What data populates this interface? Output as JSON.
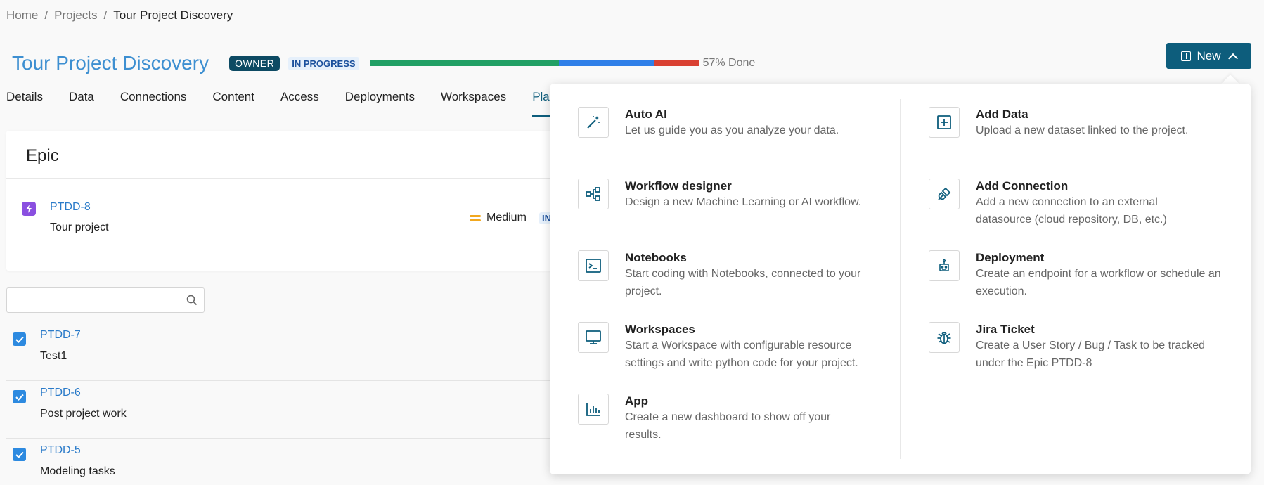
{
  "breadcrumb": {
    "items": [
      "Home",
      "Projects",
      "Tour Project Discovery"
    ],
    "separator": "/"
  },
  "project": {
    "title": "Tour Project Discovery",
    "role_badge": "OWNER",
    "status_badge": "IN PROGRESS",
    "progress_label": "57% Done",
    "progress_segments": [
      {
        "status": "done",
        "fraction": 0.57,
        "color": "#22a065"
      },
      {
        "status": "in_progress",
        "fraction": 0.29,
        "color": "#2f7fe8"
      },
      {
        "status": "other",
        "fraction": 0.14,
        "color": "#d94032"
      }
    ]
  },
  "new_button": {
    "label": "New",
    "icon": "plus-square-icon",
    "chevron": "chevron-up-icon"
  },
  "tabs": [
    {
      "label": "Details",
      "active": false
    },
    {
      "label": "Data",
      "active": false
    },
    {
      "label": "Connections",
      "active": false
    },
    {
      "label": "Content",
      "active": false
    },
    {
      "label": "Access",
      "active": false
    },
    {
      "label": "Deployments",
      "active": false
    },
    {
      "label": "Workspaces",
      "active": false
    },
    {
      "label": "Planni",
      "active": true
    }
  ],
  "epic": {
    "heading": "Epic",
    "key": "PTDD-8",
    "summary": "Tour project",
    "priority": "Medium",
    "status_fragment": "IN",
    "icon": "lightning-icon"
  },
  "search": {
    "value": "",
    "placeholder": ""
  },
  "tasks": [
    {
      "key": "PTDD-7",
      "summary": "Test1",
      "checked": true
    },
    {
      "key": "PTDD-6",
      "summary": "Post project work",
      "checked": true
    },
    {
      "key": "PTDD-5",
      "summary": "Modeling tasks",
      "checked": true
    }
  ],
  "new_menu": {
    "left": [
      {
        "title": "Auto AI",
        "description": "Let us guide you as you analyze your data.",
        "icon": "magic-wand-icon"
      },
      {
        "title": "Workflow designer",
        "description": "Design a new Machine Learning or AI workflow.",
        "icon": "workflow-icon"
      },
      {
        "title": "Notebooks",
        "description": "Start coding with Notebooks, connected to your project.",
        "icon": "terminal-icon"
      },
      {
        "title": "Workspaces",
        "description": "Start a Workspace with configurable resource settings and write python code for your project.",
        "icon": "monitor-icon"
      },
      {
        "title": "App",
        "description": "Create a new dashboard to show off your results.",
        "icon": "bar-chart-icon"
      }
    ],
    "right": [
      {
        "title": "Add Data",
        "description": "Upload a new dataset linked to the project.",
        "icon": "plus-square-icon"
      },
      {
        "title": "Add Connection",
        "description": "Add a new connection to an external datasource (cloud repository, DB, etc.)",
        "icon": "plug-icon"
      },
      {
        "title": "Deployment",
        "description": "Create an endpoint for a workflow or schedule an execution.",
        "icon": "robot-icon"
      },
      {
        "title": "Jira Ticket",
        "description": "Create a User Story / Bug / Task to be tracked under the Epic PTDD-8",
        "icon": "bug-icon"
      }
    ]
  },
  "colors": {
    "accent": "#0d5d7c",
    "title_blue": "#3d8fd1",
    "link_blue": "#2b7bc9",
    "epic_purple": "#8a4fe0",
    "priority_orange": "#f2a81f",
    "check_blue": "#2d8ae0"
  }
}
